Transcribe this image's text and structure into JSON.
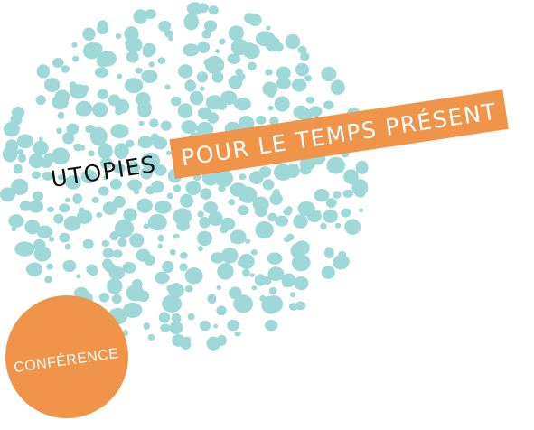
{
  "colors": {
    "dot": "#9ed9d8",
    "accent": "#f0944a",
    "text_dark": "#111111",
    "text_light": "#ffffff"
  },
  "title": {
    "word": "UTOPIES",
    "band": "POUR LE TEMPS PRÉSENT"
  },
  "badge": {
    "label": "CONFÉRENCE"
  },
  "decoration": {
    "icon": "dot-cloud-pattern"
  }
}
